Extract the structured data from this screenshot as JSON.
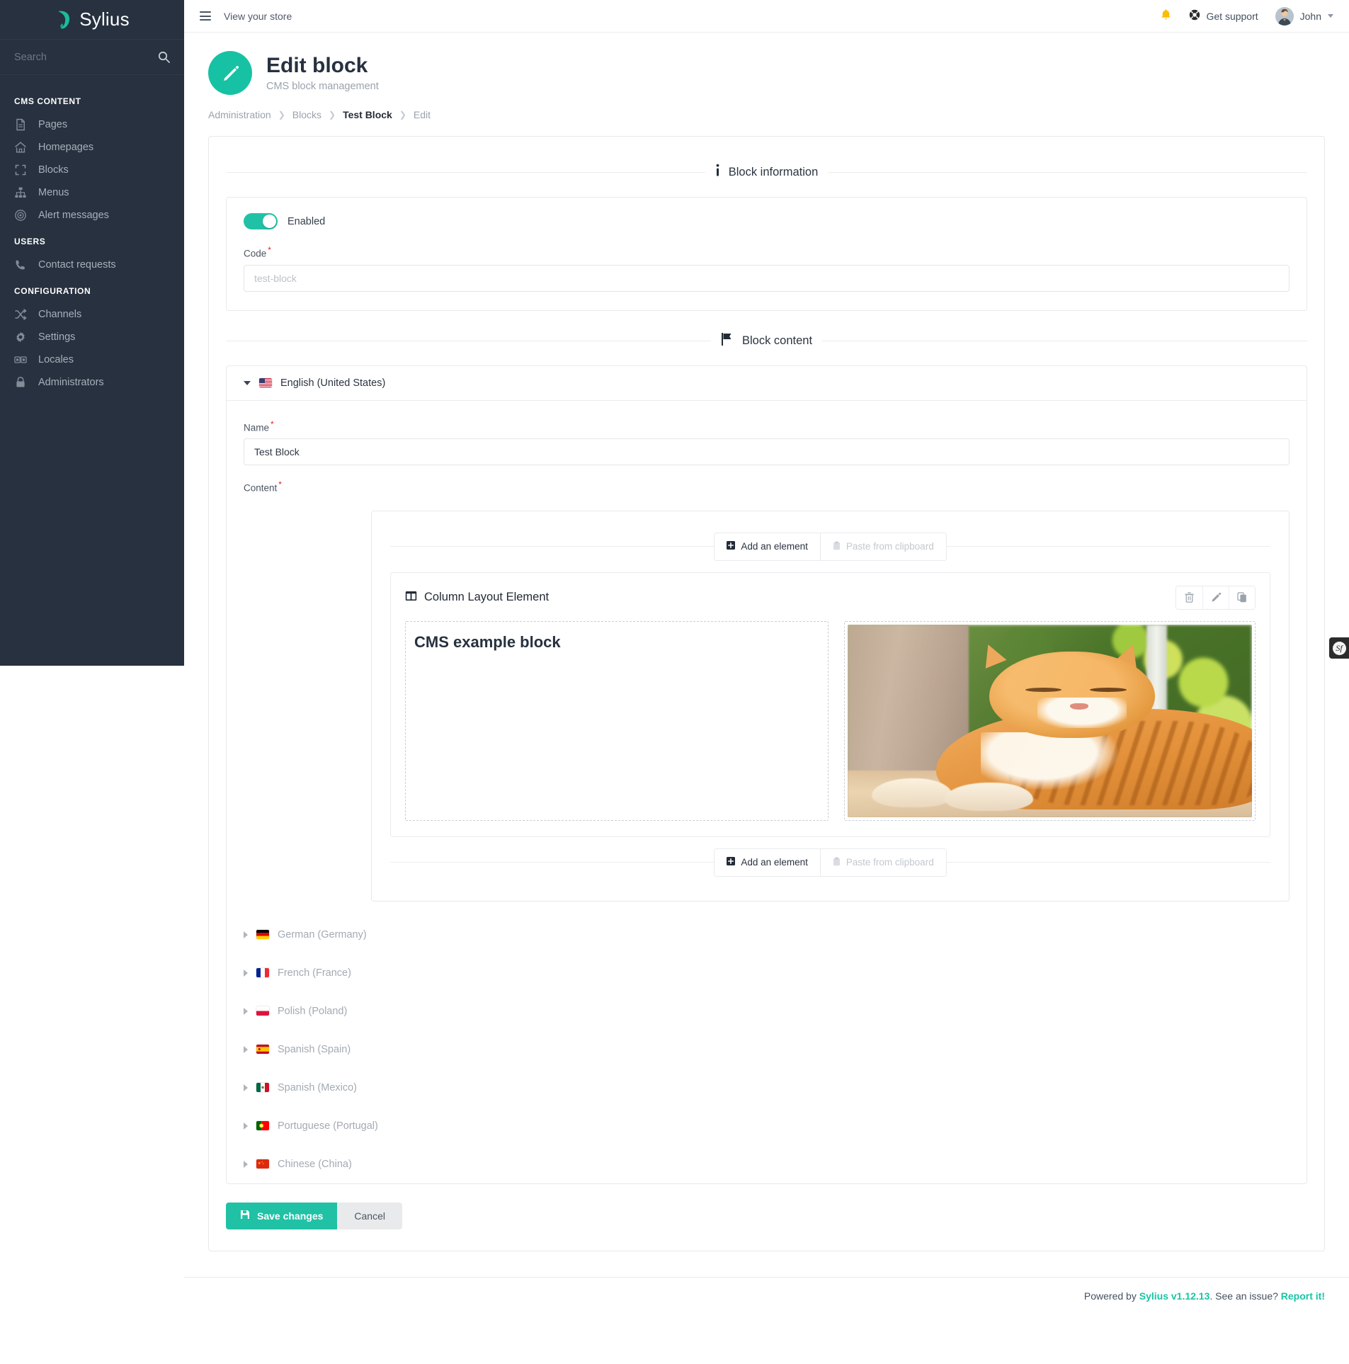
{
  "sidebar": {
    "brand": "Sylius",
    "search_placeholder": "Search",
    "groups": [
      {
        "title": "CMS CONTENT",
        "items": [
          {
            "label": "Pages",
            "icon": "file-icon"
          },
          {
            "label": "Homepages",
            "icon": "home-icon"
          },
          {
            "label": "Blocks",
            "icon": "blocks-icon"
          },
          {
            "label": "Menus",
            "icon": "sitemap-icon"
          },
          {
            "label": "Alert messages",
            "icon": "broadcast-icon"
          }
        ]
      },
      {
        "title": "USERS",
        "items": [
          {
            "label": "Contact requests",
            "icon": "phone-icon"
          }
        ]
      },
      {
        "title": "CONFIGURATION",
        "items": [
          {
            "label": "Channels",
            "icon": "shuffle-icon"
          },
          {
            "label": "Settings",
            "icon": "gear-icon"
          },
          {
            "label": "Locales",
            "icon": "locales-icon"
          },
          {
            "label": "Administrators",
            "icon": "lock-icon"
          }
        ]
      }
    ]
  },
  "topbar": {
    "view_store": "View your store",
    "support": "Get support",
    "user": "John"
  },
  "header": {
    "title": "Edit block",
    "subtitle": "CMS block management"
  },
  "breadcrumb": [
    {
      "label": "Administration",
      "active": false
    },
    {
      "label": "Blocks",
      "active": false
    },
    {
      "label": "Test Block",
      "active": true
    },
    {
      "label": "Edit",
      "active": false
    }
  ],
  "block_information": {
    "section_title": "Block information",
    "enabled_label": "Enabled",
    "enabled": true,
    "code_label": "Code",
    "code_value": "",
    "code_placeholder": "test-block"
  },
  "block_content": {
    "section_title": "Block content",
    "active_locale": {
      "label": "English (United States)",
      "flag": "us-flag"
    },
    "name_label": "Name",
    "name_value": "Test Block",
    "content_label": "Content",
    "add_element_label": "Add an element",
    "paste_label": "Paste from clipboard",
    "element": {
      "title": "Column Layout Element",
      "icon": "columns-icon",
      "actions": [
        "delete-icon",
        "edit-icon",
        "duplicate-icon"
      ],
      "column_one_heading": "CMS example block",
      "column_two_image_alt": "sleeping orange tabby cat"
    },
    "other_locales": [
      {
        "label": "German (Germany)",
        "flag": "de-flag"
      },
      {
        "label": "French (France)",
        "flag": "fr-flag"
      },
      {
        "label": "Polish (Poland)",
        "flag": "pl-flag"
      },
      {
        "label": "Spanish (Spain)",
        "flag": "es-flag"
      },
      {
        "label": "Spanish (Mexico)",
        "flag": "mx-flag"
      },
      {
        "label": "Portuguese (Portugal)",
        "flag": "pt-flag"
      },
      {
        "label": "Chinese (China)",
        "flag": "cn-flag"
      }
    ]
  },
  "actions": {
    "save": "Save changes",
    "cancel": "Cancel"
  },
  "footer": {
    "powered_prefix": "Powered by ",
    "sylius_version": "Sylius v1.12.13",
    "issue_text": ". See an issue? ",
    "report": "Report it!"
  },
  "colors": {
    "accent": "#21c1a5",
    "sidebar_bg": "#27313f",
    "bell": "#fbbd08",
    "required": "#db2828"
  }
}
